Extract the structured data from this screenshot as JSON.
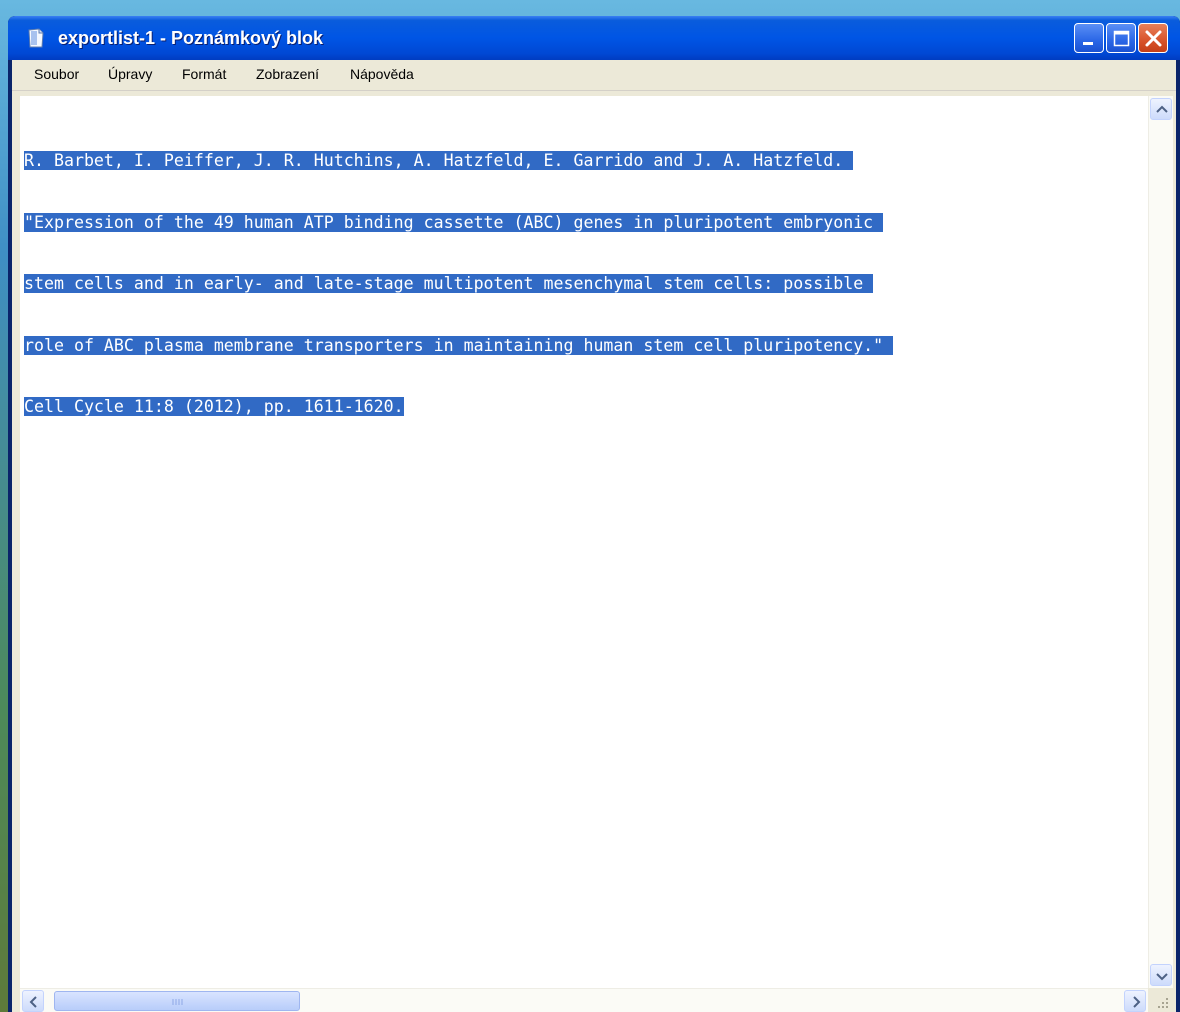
{
  "window": {
    "title": "exportlist-1 - Poznámkový blok"
  },
  "menu": {
    "items": [
      {
        "label": "Soubor"
      },
      {
        "label": "Úpravy"
      },
      {
        "label": "Formát"
      },
      {
        "label": "Zobrazení"
      },
      {
        "label": "Nápověda"
      }
    ]
  },
  "editor": {
    "lines": [
      "R. Barbet, I. Peiffer, J. R. Hutchins, A. Hatzfeld, E. Garrido and J. A. Hatzfeld. ",
      "\"Expression of the 49 human ATP binding cassette (ABC) genes in pluripotent embryonic ",
      "stem cells and in early- and late-stage multipotent mesenchymal stem cells: possible ",
      "role of ABC plasma membrane transporters in maintaining human stem cell pluripotency.\" ",
      "Cell Cycle 11:8 (2012), pp. 1611-1620."
    ],
    "selection_color": "#316ac5"
  },
  "colors": {
    "titlebar": "#0055e5",
    "close_button": "#d8532a",
    "menubar": "#ece9d8"
  },
  "icons": {
    "app": "notepad-icon",
    "minimize": "minimize-icon",
    "maximize": "maximize-icon",
    "close": "close-icon",
    "scroll_up": "chevron-up-icon",
    "scroll_down": "chevron-down-icon",
    "scroll_left": "chevron-left-icon",
    "scroll_right": "chevron-right-icon"
  }
}
